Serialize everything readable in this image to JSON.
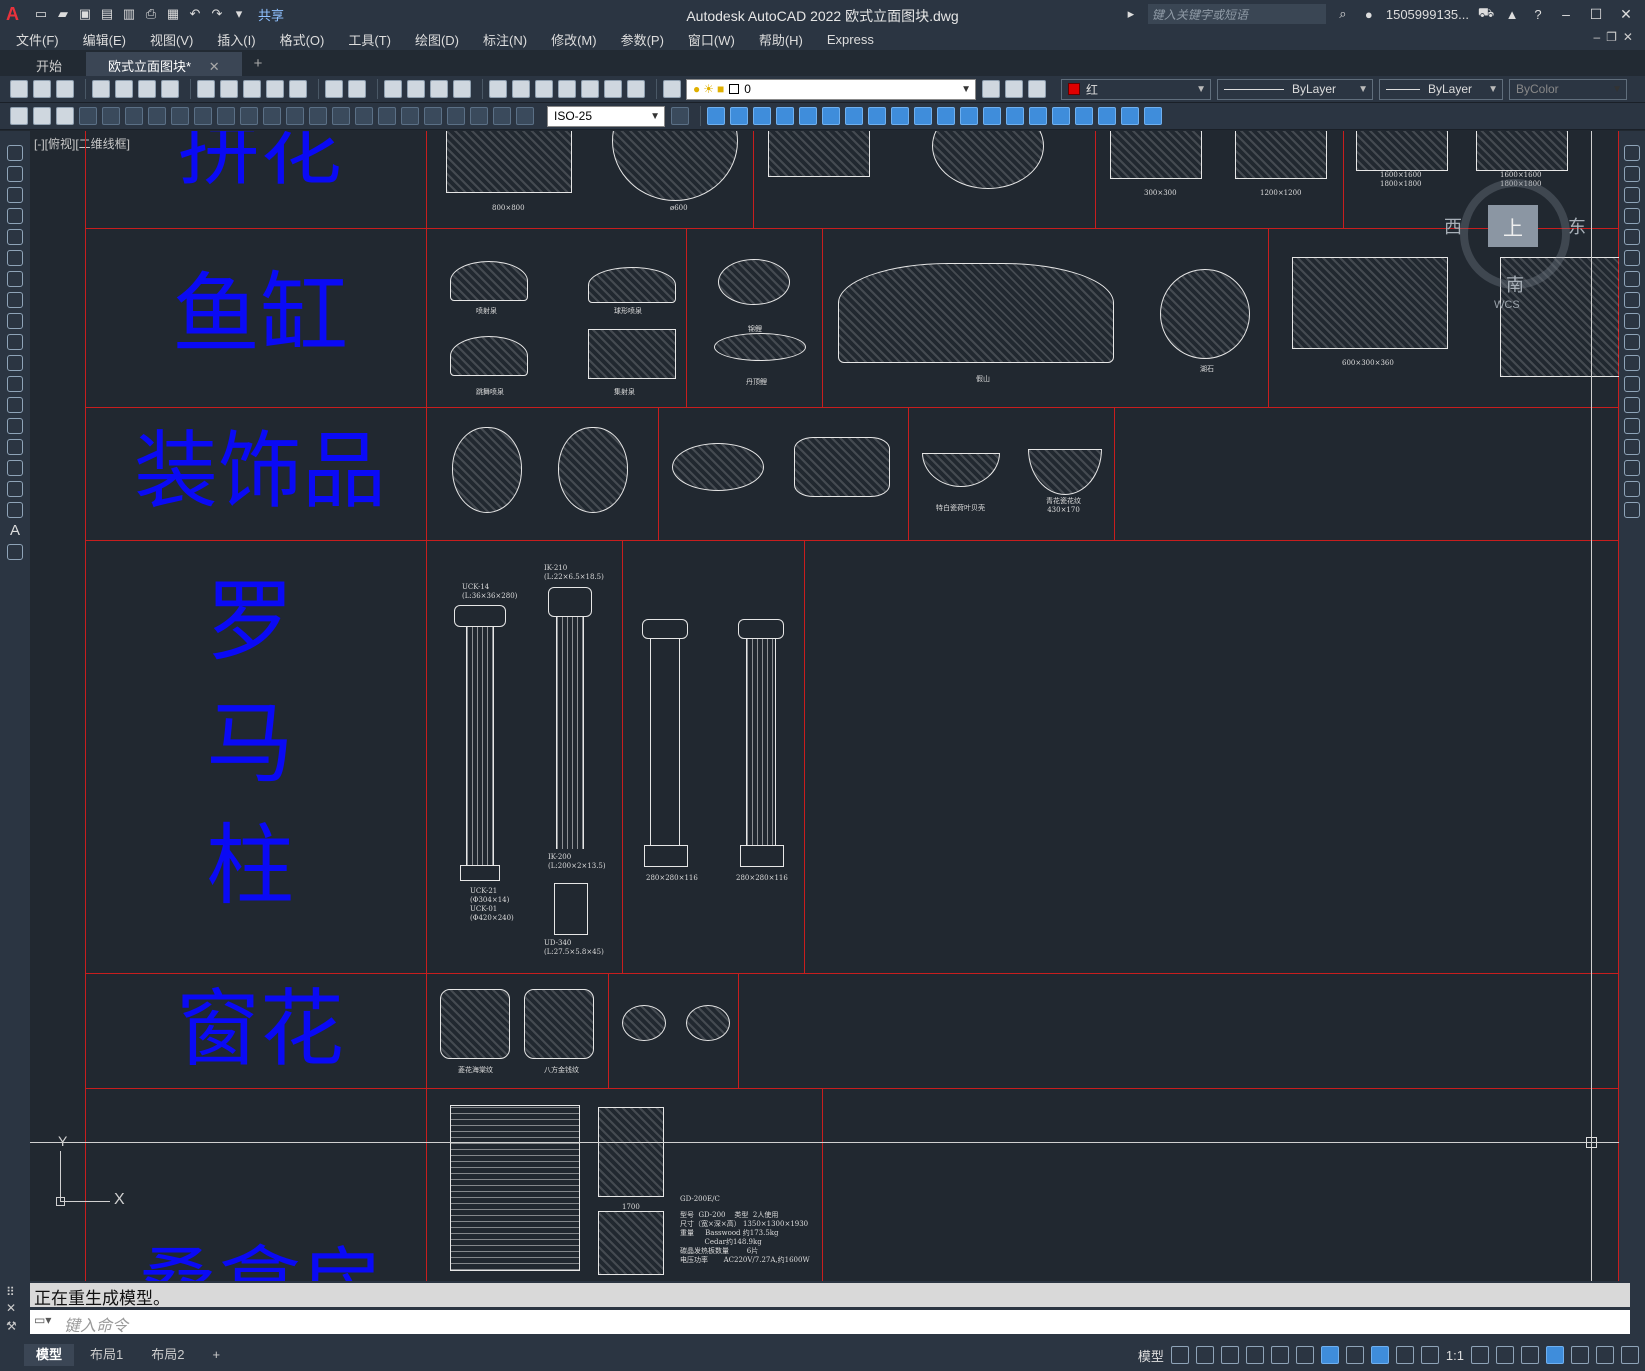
{
  "app": {
    "logo": "A",
    "title": "Autodesk AutoCAD 2022    欧式立面图块.dwg",
    "share": "共享",
    "search_placeholder": "键入关键字或短语",
    "user": "1505999135...",
    "win_minimize": "–",
    "win_maximize": "☐",
    "win_close": "✕"
  },
  "menu": [
    "文件(F)",
    "编辑(E)",
    "视图(V)",
    "插入(I)",
    "格式(O)",
    "工具(T)",
    "绘图(D)",
    "标注(N)",
    "修改(M)",
    "参数(P)",
    "窗口(W)",
    "帮助(H)",
    "Express"
  ],
  "tabs": {
    "start": "开始",
    "active": "欧式立面图块*",
    "close": "✕",
    "add": "+"
  },
  "toolbar": {
    "layer": "0",
    "color": "红",
    "linetype": "ByLayer",
    "lineweight": "ByLayer",
    "plotstyle": "ByColor",
    "dimstyle": "ISO-25"
  },
  "viewport": {
    "label": "[-][俯视][二维线框]"
  },
  "viewcube": {
    "top": "上",
    "west": "西",
    "east": "东",
    "south": "南",
    "wcs": "WCS"
  },
  "ucs": {
    "x": "X",
    "y": "Y"
  },
  "categories": {
    "pinhua": "拼花",
    "yugang": "鱼缸",
    "zhuangshipin": "装饰品",
    "luomazhu": "罗马柱",
    "chuanghua": "窗花",
    "sangna": "桑拿房"
  },
  "labels": {
    "pinhua": [
      "800×800",
      "ø600",
      "1200×1200",
      "1600×1600\n1800×1800",
      "1600×1600\n1800×1800",
      "300×300"
    ],
    "yugang": [
      "喷射泉",
      "球形喷泉",
      "跳舞喷泉",
      "集射泉",
      "锦鲤",
      "丹顶鲤",
      "假山",
      "湖石",
      "600×300×360"
    ],
    "zhuangshipin": [
      "特白瓷荷叶贝壳",
      "青花瓷花纹\n430×170"
    ],
    "luomazhu": [
      "UCK-14\n(L:36×36×280)",
      "IK-210\n(L:22×6.5×18.5)",
      "IK-200\n(L:200×2×13.5)",
      "UCK-21\n(Φ304×14)\nUCK-01\n(Φ420×240)",
      "UD-340\n(L:27.5×5.8×45)",
      "280×280×116",
      "280×280×116"
    ],
    "chuanghua": [
      "菱花海棠纹",
      "八方金钱纹"
    ],
    "sangna": [
      "GD-200E/C",
      "型号  GD-200    类型  2人使用\n尺寸（宽×深×高） 1350×1300×1930\n重量     Basswood 约173.5kg\n           Cedar约148.9kg\n碳晶发热板数量        6片\n电压功率       AC220V/7.27A,约1600W",
      "1700"
    ]
  },
  "command": {
    "history": "正在重生成模型。",
    "placeholder": "键入命令"
  },
  "layouts": [
    "模型",
    "布局1",
    "布局2"
  ],
  "status": {
    "mode": "模型",
    "scale": "1:1",
    "add": "+"
  }
}
